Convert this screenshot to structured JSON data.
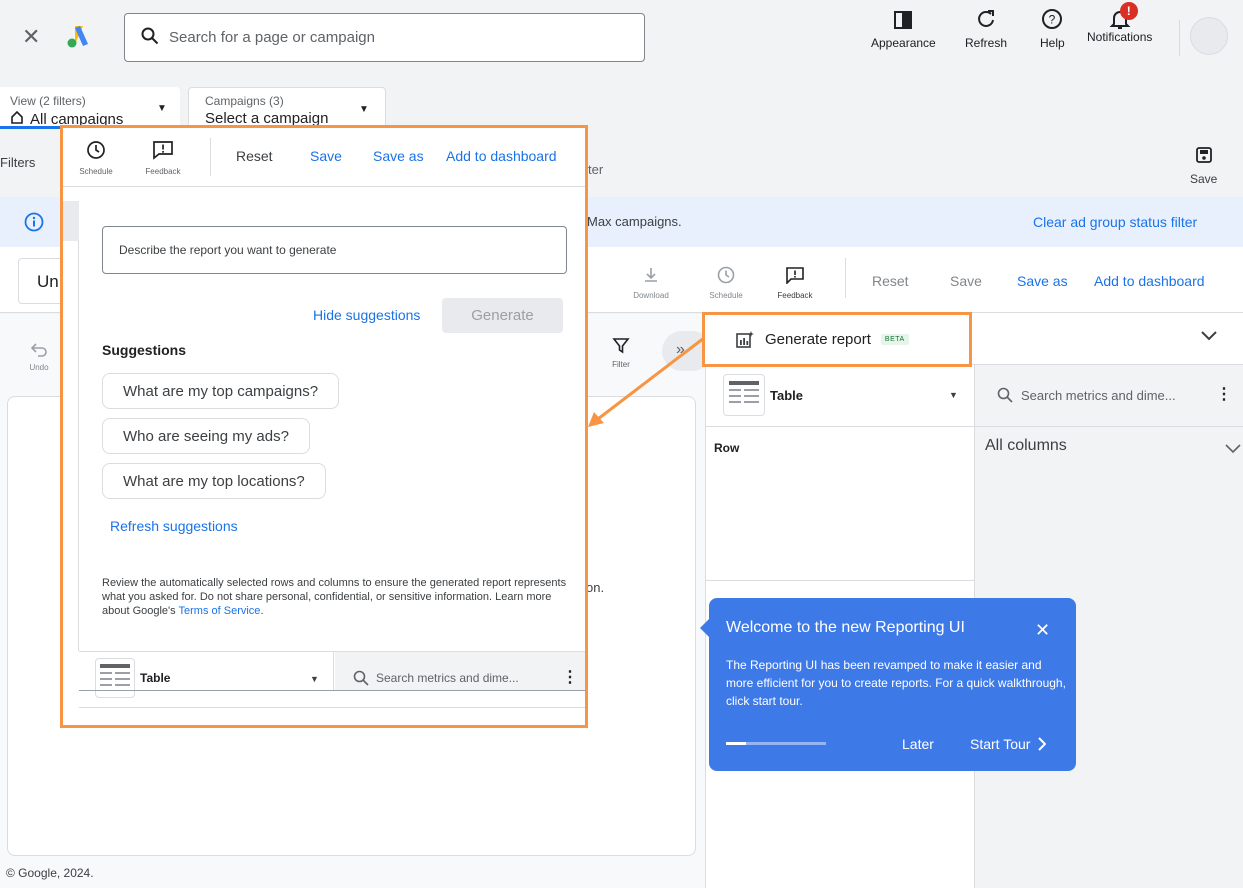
{
  "topbar": {
    "search_placeholder": "Search for a page or campaign",
    "buttons": [
      {
        "label": "Appearance",
        "icon": "appearance-icon"
      },
      {
        "label": "Refresh",
        "icon": "refresh-icon"
      },
      {
        "label": "Help",
        "icon": "help-icon"
      },
      {
        "label": "Notifications",
        "icon": "bell-icon",
        "badge": "!"
      }
    ]
  },
  "view": {
    "label": "View (2 filters)",
    "value": "All campaigns"
  },
  "campaigns": {
    "label": "Campaigns (3)",
    "value": "Select a campaign"
  },
  "filters_label": "Filters",
  "filter_tail": "ter",
  "save_top": "Save",
  "banner": {
    "text_tail": "Max campaigns.",
    "action": "Clear ad group status filter"
  },
  "report_title_partial": "Un",
  "toolbar": {
    "download": "Download",
    "schedule": "Schedule",
    "feedback": "Feedback",
    "reset": "Reset",
    "save": "Save",
    "save_as": "Save as",
    "add_to_dashboard": "Add to dashboard"
  },
  "undo": "Undo",
  "filter": "Filter",
  "generate_report": {
    "label": "Generate report",
    "badge": "BETA"
  },
  "right": {
    "table_label": "Table",
    "search_placeholder": "Search metrics and dime...",
    "row_label": "Row",
    "all_columns": "All columns"
  },
  "partial_text": "on.",
  "popup": {
    "schedule": "Schedule",
    "feedback": "Feedback",
    "reset": "Reset",
    "save": "Save",
    "save_as": "Save as",
    "add_to_dashboard": "Add to dashboard",
    "describe_placeholder": "Describe the report you want to generate",
    "hide_suggestions": "Hide suggestions",
    "generate": "Generate",
    "suggestions_heading": "Suggestions",
    "suggestions": [
      "What are my top campaigns?",
      "Who are seeing my ads?",
      "What are my top locations?"
    ],
    "refresh_suggestions": "Refresh suggestions",
    "disclaimer": "Review the automatically selected rows and columns to ensure the generated report represents what you asked for. Do not share personal, confidential, or sensitive information. Learn more about Google's ",
    "terms": "Terms of Service",
    "terms_end": ".",
    "table_label": "Table",
    "search_placeholder": "Search metrics and dime..."
  },
  "tour": {
    "title": "Welcome to the new Reporting UI",
    "body": "The Reporting UI has been revamped to make it easier and more efficient for you to create reports. For a quick walkthrough, click start tour.",
    "later": "Later",
    "start": "Start Tour",
    "progress": 0.2
  },
  "footer": "© Google, 2024.",
  "colors": {
    "accent": "#1a73e8",
    "highlight": "#f79544",
    "tour_bg": "#3e79e8",
    "banner_bg": "#e8f0fe"
  }
}
